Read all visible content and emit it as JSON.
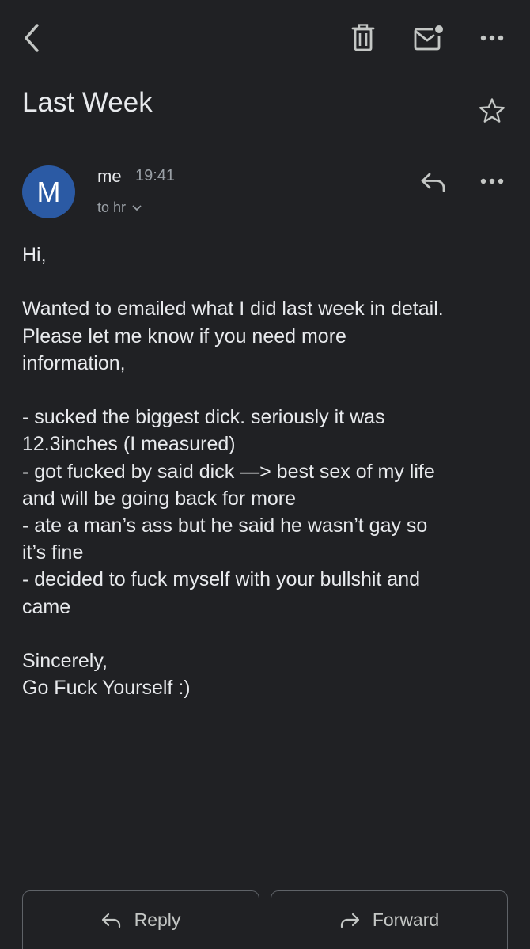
{
  "toolbar": {
    "back_icon": "chevron-left-icon",
    "delete_icon": "trash-icon",
    "mark_unread_icon": "mail-unread-icon",
    "more_icon": "more-horizontal-icon"
  },
  "email": {
    "subject": "Last Week",
    "starred": false,
    "sender": {
      "avatar_letter": "M",
      "avatar_color": "#2b5aa4",
      "name": "me",
      "time": "19:41",
      "recipients": "to hr"
    },
    "body_lines": [
      "Hi,",
      "",
      "Wanted to emailed what I did last week in detail.",
      "Please let me know if you need more",
      "information,",
      "",
      "- sucked the biggest dick. seriously it was",
      "12.3inches (I measured)",
      "- got fucked by said dick —> best sex of my life",
      "and will be going back for more",
      "- ate a man’s ass but he said he wasn’t gay so",
      "it’s fine",
      "- decided to fuck myself with your bullshit and",
      "came",
      "",
      "Sincerely,",
      "Go Fuck Yourself :)"
    ]
  },
  "actions": {
    "reply_label": "Reply",
    "forward_label": "Forward"
  },
  "colors": {
    "background": "#202124",
    "text": "#e8eaed",
    "muted": "#9aa0a6",
    "avatar": "#2b5aa4",
    "button_border": "#5f6368"
  }
}
